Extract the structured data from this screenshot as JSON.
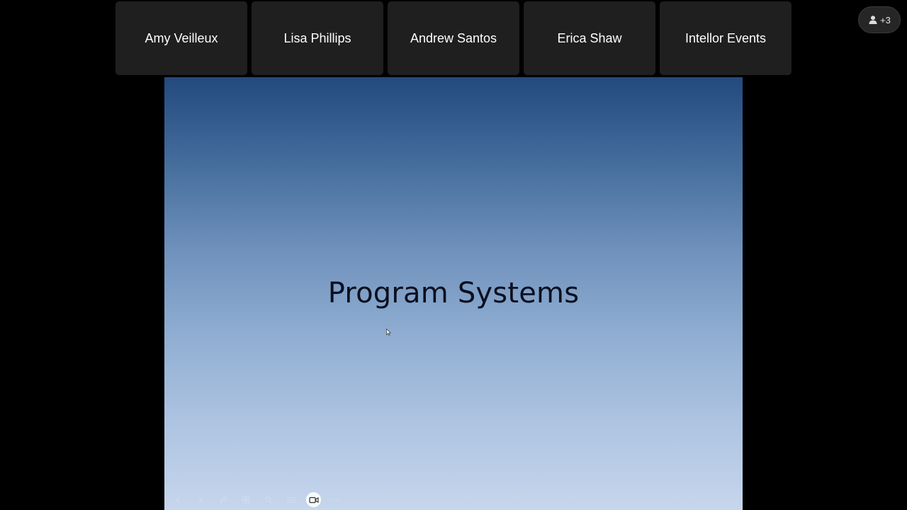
{
  "participants": [
    {
      "name": "Amy Veilleux"
    },
    {
      "name": "Lisa Phillips"
    },
    {
      "name": "Andrew Santos"
    },
    {
      "name": "Erica Shaw"
    },
    {
      "name": "Intellor Events"
    }
  ],
  "more_participants": {
    "label": "+3",
    "icon": "person-icon"
  },
  "slide": {
    "title": "Program Systems",
    "gradient_top": "#23497e",
    "gradient_bottom": "#c6d6ec"
  },
  "slide_toolbar": {
    "icons": [
      "previous-slide-icon",
      "next-slide-icon",
      "pen-icon",
      "slides-grid-icon",
      "zoom-icon",
      "subtitles-icon",
      "camera-icon",
      "more-icon"
    ],
    "active": "camera-icon"
  },
  "colors": {
    "background": "#000000",
    "tile": "#1f1f1f",
    "tile_text": "#ffffff"
  }
}
